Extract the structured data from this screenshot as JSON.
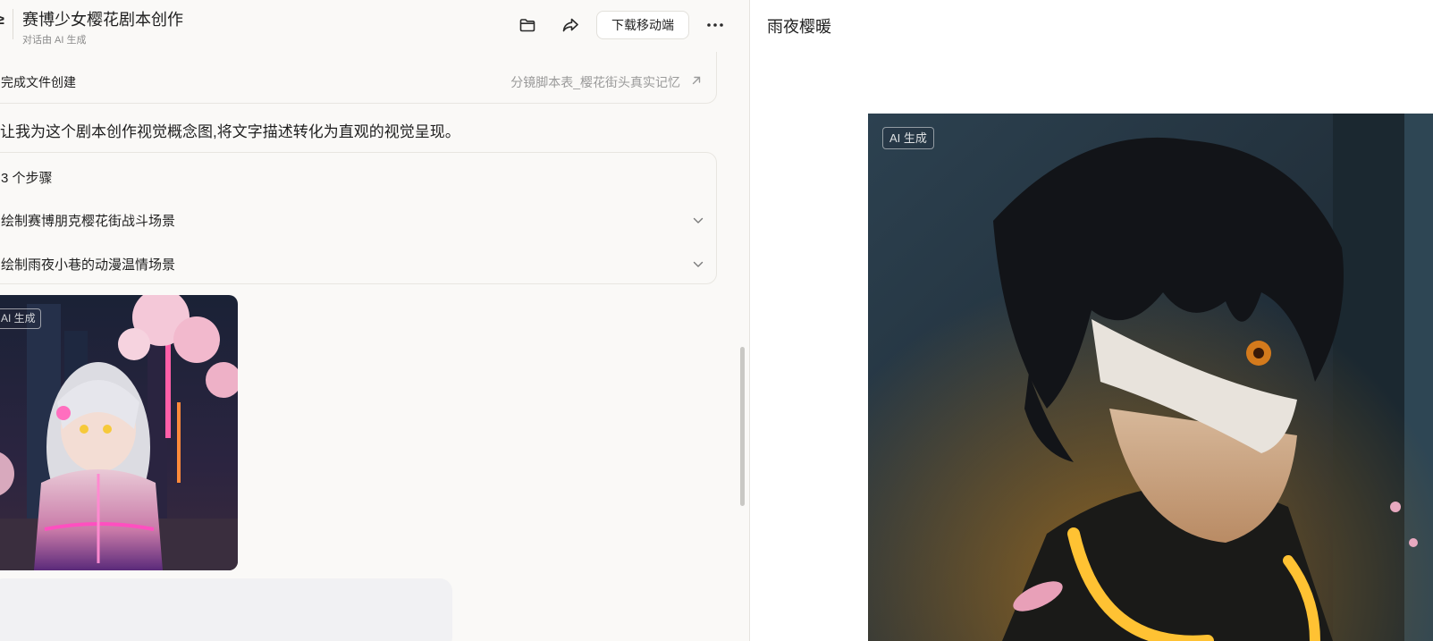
{
  "header": {
    "title": "赛博少女樱花剧本创作",
    "subtitle": "对话由 AI 生成",
    "download_label": "下载移动端"
  },
  "file_card": {
    "status": "完成文件创建",
    "link": "分镜脚本表_樱花街头真实记忆"
  },
  "message": {
    "text": "让我为这个剧本创作视觉概念图,将文字描述转化为直观的视觉呈现。"
  },
  "steps": {
    "count": "3 个步骤",
    "items": [
      {
        "label": "绘制赛博朋克樱花街战斗场景"
      },
      {
        "label": "绘制雨夜小巷的动漫温情场景"
      }
    ]
  },
  "thumbnail": {
    "badge": "AI 生成"
  },
  "preview": {
    "title": "雨夜樱暖",
    "badge": "AI 生成"
  },
  "icons": [
    "folder-icon",
    "share-icon",
    "more-icon",
    "arrow-up-right-icon",
    "chevron-down-icon"
  ],
  "colors": {
    "panel_bg": "#faf9f7",
    "border": "#e8e6e1",
    "muted_text": "#9a9a9a",
    "input_bg": "#f1f1f3"
  }
}
